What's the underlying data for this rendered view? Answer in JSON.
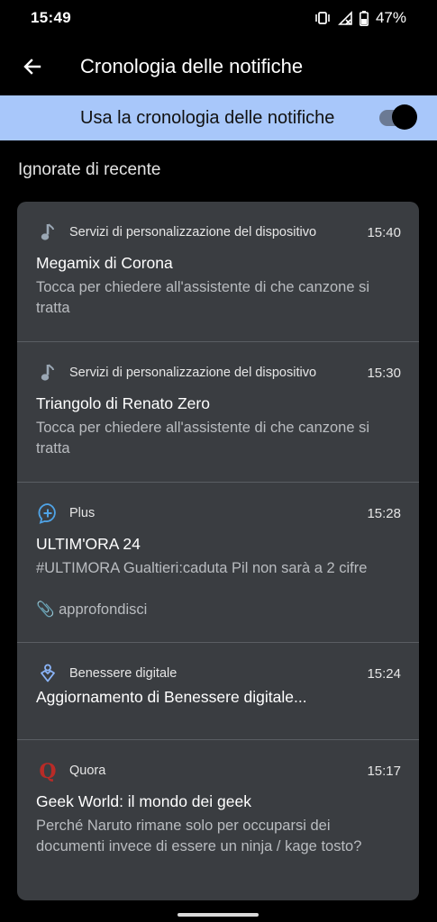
{
  "status_bar": {
    "time": "15:49",
    "battery": "47%",
    "icons": [
      "vibrate-icon",
      "no-signal-icon",
      "battery-icon"
    ]
  },
  "appbar": {
    "title": "Cronologia delle notifiche",
    "back_icon": "arrow-back-icon"
  },
  "master_switch": {
    "label": "Usa la cronologia delle notifiche",
    "state": "on"
  },
  "section": {
    "title": "Ignorate di recente"
  },
  "notifications": [
    {
      "icon": "music-note-icon",
      "app": "Servizi di personalizzazione del dispositivo",
      "time": "15:40",
      "title": "Megamix di Corona",
      "body": "Tocca per chiedere all'assistente di che canzone si tratta"
    },
    {
      "icon": "music-note-icon",
      "app": "Servizi di personalizzazione del dispositivo",
      "time": "15:30",
      "title": "Triangolo di Renato Zero",
      "body": "Tocca per chiedere all'assistente di che canzone si tratta"
    },
    {
      "icon": "plus-chat-icon",
      "app": "Plus",
      "time": "15:28",
      "title": "ULTIM'ORA 24",
      "body": "#ULTIMORA Gualtieri:caduta Pil non sarà a 2 cifre",
      "extra": "📎 approfondisci"
    },
    {
      "icon": "digital-wellbeing-icon",
      "app": "Benessere digitale",
      "time": "15:24",
      "title": "Aggiornamento di Benessere digitale...",
      "body": ""
    },
    {
      "icon": "quora-logo-icon",
      "app": "Quora",
      "time": "15:17",
      "title": "Geek World: il mondo dei geek",
      "body": "Perché Naruto rimane solo per occuparsi dei documenti invece di essere un ninja / kage tosto?"
    }
  ],
  "colors": {
    "background": "#000000",
    "card": "#3a3d41",
    "highlight": "#a8c7fa",
    "plus_accent": "#4fa3e6",
    "quora_red": "#b92b27"
  }
}
